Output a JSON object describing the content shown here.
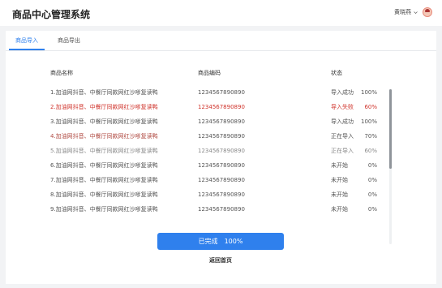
{
  "header": {
    "title": "商品中心管理系统",
    "user_name": "黄晓燕"
  },
  "tabs": [
    {
      "label": "商品导入",
      "active": true
    },
    {
      "label": "商品导出",
      "active": false
    }
  ],
  "table": {
    "columns": [
      "商品名称",
      "商品编码",
      "状态"
    ],
    "rows": [
      {
        "name": "1.加油网抖音、中餐厅同款网红沙嗲复读鸭",
        "code": "1234567890890",
        "status": "导入成功",
        "progress": "100%"
      },
      {
        "name": "2.加油网抖音、中餐厅同款网红沙嗲复读鸭",
        "code": "1234567890890",
        "status": "导入失败",
        "progress": "60%"
      },
      {
        "name": "3.加油网抖音、中餐厅同款网红沙嗲复读鸭",
        "code": "1234567890890",
        "status": "导入成功",
        "progress": "100%"
      },
      {
        "name": "4.加油网抖音、中餐厅同款网红沙嗲复读鸭",
        "code": "1234567890890",
        "status": "正在导入",
        "progress": "70%"
      },
      {
        "name": "5.加油网抖音、中餐厅同款网红沙嗲复读鸭",
        "code": "1234567890890",
        "status": "正在导入",
        "progress": "60%"
      },
      {
        "name": "6.加油网抖音、中餐厅同款网红沙嗲复读鸭",
        "code": "1234567890890",
        "status": "未开始",
        "progress": "0%"
      },
      {
        "name": "7.加油网抖音、中餐厅同款网红沙嗲复读鸭",
        "code": "1234567890890",
        "status": "未开始",
        "progress": "0%"
      },
      {
        "name": "8.加油网抖音、中餐厅同款网红沙嗲复读鸭",
        "code": "1234567890890",
        "status": "未开始",
        "progress": "0%"
      },
      {
        "name": "9.加油网抖音、中餐厅同款网红沙嗲复读鸭",
        "code": "1234567890890",
        "status": "未开始",
        "progress": "0%"
      }
    ]
  },
  "footer": {
    "done_label": "已完成",
    "done_progress": "100%",
    "back_label": "返回首页"
  },
  "colors": {
    "accent": "#2f80ed",
    "error": "#d0342c"
  }
}
